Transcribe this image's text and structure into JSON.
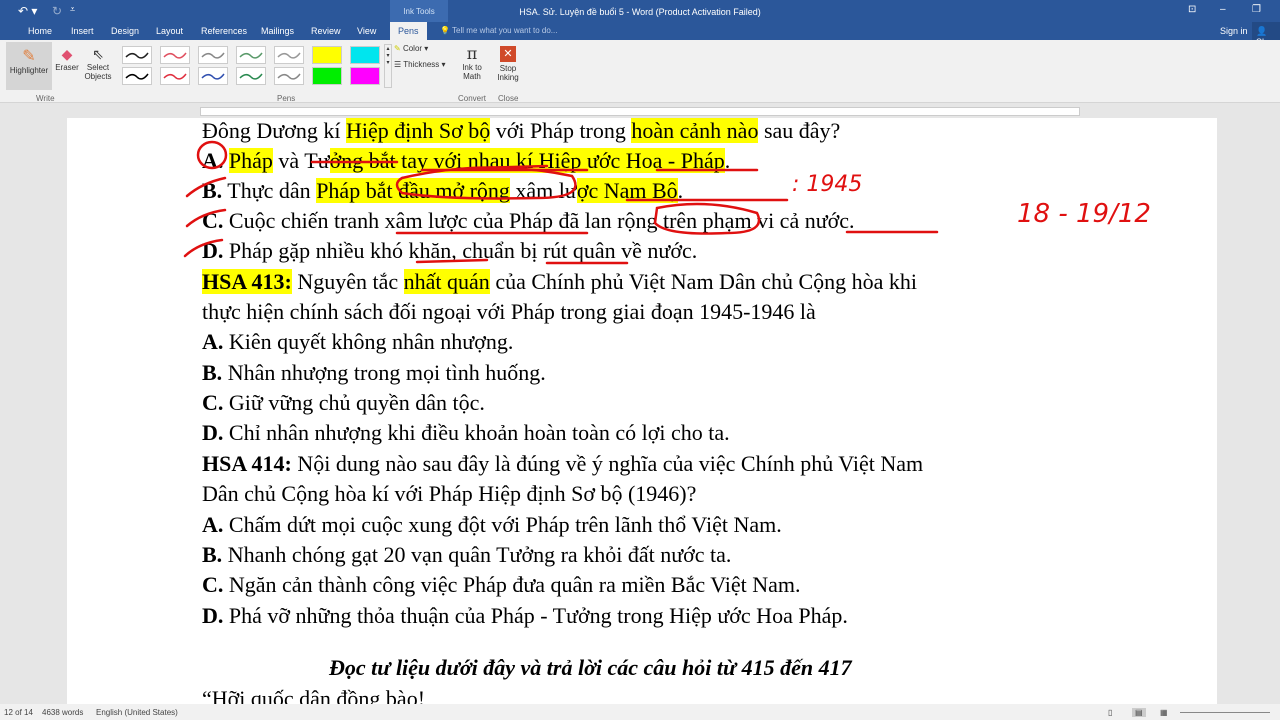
{
  "window": {
    "title": "HSA. Sử. Luyện đề buổi 5 - Word (Product Activation Failed)",
    "context_tab": "Ink Tools",
    "sign_in": "Sign in",
    "share": "Sh"
  },
  "tabs": [
    "Home",
    "Insert",
    "Design",
    "Layout",
    "References",
    "Mailings",
    "Review",
    "View",
    "Pens"
  ],
  "tell_me": "Tell me what you want to do...",
  "ribbon": {
    "write": {
      "label": "Write",
      "highlighter": "Highlighter",
      "eraser": "Eraser",
      "select_objects": "Select Objects"
    },
    "pens": {
      "label": "Pens",
      "color": "Color",
      "thickness": "Thickness",
      "swatches": [
        "#222222",
        "#e05060",
        "#888888",
        "#5a9a6a",
        "#999999",
        "#ffff00",
        "#00e5ee",
        "#000000",
        "#e03040",
        "#3050b0",
        "#2a8a50",
        "#888888",
        "#00ee00",
        "#ff00ff"
      ]
    },
    "convert": {
      "label": "Convert",
      "ink_to_math": "Ink to Math"
    },
    "close": {
      "label": "Close",
      "stop_inking": "Stop Inking"
    }
  },
  "document": {
    "lines": [
      [
        {
          "t": "Đông Dương kí "
        },
        {
          "t": "Hiệp định Sơ bộ",
          "hl": 1
        },
        {
          "t": " với Pháp trong "
        },
        {
          "t": "hoàn cảnh nào",
          "hl": 1
        },
        {
          "t": " sau đây?"
        }
      ],
      [
        {
          "t": "A.",
          "b": 1
        },
        {
          "t": " "
        },
        {
          "t": "Pháp",
          "hl": 1
        },
        {
          "t": " và Tư"
        },
        {
          "t": "ởng bắt tay với nhau kí H",
          "hl": 1
        },
        {
          "t": "iệp ước Hoa - Pháp",
          "hl": 1
        },
        {
          "t": "."
        }
      ],
      [
        {
          "t": "B.",
          "b": 1
        },
        {
          "t": " Thực dân "
        },
        {
          "t": "Pháp bắt đầu mở rộng",
          "hl": 1
        },
        {
          "t": " xâm lư"
        },
        {
          "t": "ợc Nam Bộ",
          "hl": 1
        },
        {
          "t": "."
        }
      ],
      [
        {
          "t": "C.",
          "b": 1
        },
        {
          "t": " Cuộc chiến tranh xâm lược của Pháp đã lan rộng trên phạm vi cả nước."
        }
      ],
      [
        {
          "t": "D.",
          "b": 1
        },
        {
          "t": " Pháp gặp nhiều khó khăn, chuẩn bị rút quân về nước."
        }
      ],
      [
        {
          "t": "HSA 413:",
          "b": 1,
          "hl": 1
        },
        {
          "t": "  Nguyên tắc "
        },
        {
          "t": "nhất quán",
          "hl": 1
        },
        {
          "t": " của Chính phủ Việt Nam Dân chủ Cộng hòa khi"
        }
      ],
      [
        {
          "t": "thực hiện chính sách đối ngoại "
        },
        {
          "t": " ",
          "hl": 1
        },
        {
          "t": "với Pháp trong giai đoạn 1945-1946 là"
        }
      ],
      [
        {
          "t": "A.",
          "b": 1
        },
        {
          "t": " Kiên quyết không nhân nhượng."
        }
      ],
      [
        {
          "t": "B.",
          "b": 1
        },
        {
          "t": " Nhân nhượng trong mọi tình huống."
        }
      ],
      [
        {
          "t": "C.",
          "b": 1
        },
        {
          "t": " Giữ vững chủ quyền dân tộc."
        }
      ],
      [
        {
          "t": "D.",
          "b": 1
        },
        {
          "t": " Chỉ nhân nhượng khi điều khoản hoàn toàn có lợi cho ta."
        }
      ],
      [
        {
          "t": "HSA 414:",
          "b": 1
        },
        {
          "t": "  Nội dung nào sau đây là đúng về ý nghĩa của việc Chính phủ Việt Nam"
        }
      ],
      [
        {
          "t": "Dân chủ Cộng hòa kí với Pháp Hiệp định Sơ bộ (1946)?"
        }
      ],
      [
        {
          "t": "A.",
          "b": 1
        },
        {
          "t": " Chấm dứt mọi cuộc xung đột với Pháp trên lãnh thổ Việt Nam."
        }
      ],
      [
        {
          "t": "B.",
          "b": 1
        },
        {
          "t": " Nhanh chóng gạt 20 vạn quân Tưởng ra khỏi đất nước ta."
        }
      ],
      [
        {
          "t": "C.",
          "b": 1
        },
        {
          "t": " Ngăn cản thành công việc Pháp đưa quân ra miền Bắc Việt Nam."
        }
      ],
      [
        {
          "t": "D.",
          "b": 1
        },
        {
          "t": " Phá vỡ những thỏa thuận của Pháp - Tưởng trong Hiệp ước Hoa Pháp."
        }
      ],
      [
        {
          "t": "Đọc tư liệu dưới đây và trả lời các câu hỏi từ 415 đến 417",
          "it": 1
        }
      ],
      [
        {
          "t": "“Hỡi quốc dân đồng bào!"
        }
      ]
    ],
    "ink_notes": [
      ": 1945",
      "18 - 19/12"
    ]
  },
  "status": {
    "page": "12 of 14",
    "words": "4638 words",
    "language": "English (United States)"
  }
}
